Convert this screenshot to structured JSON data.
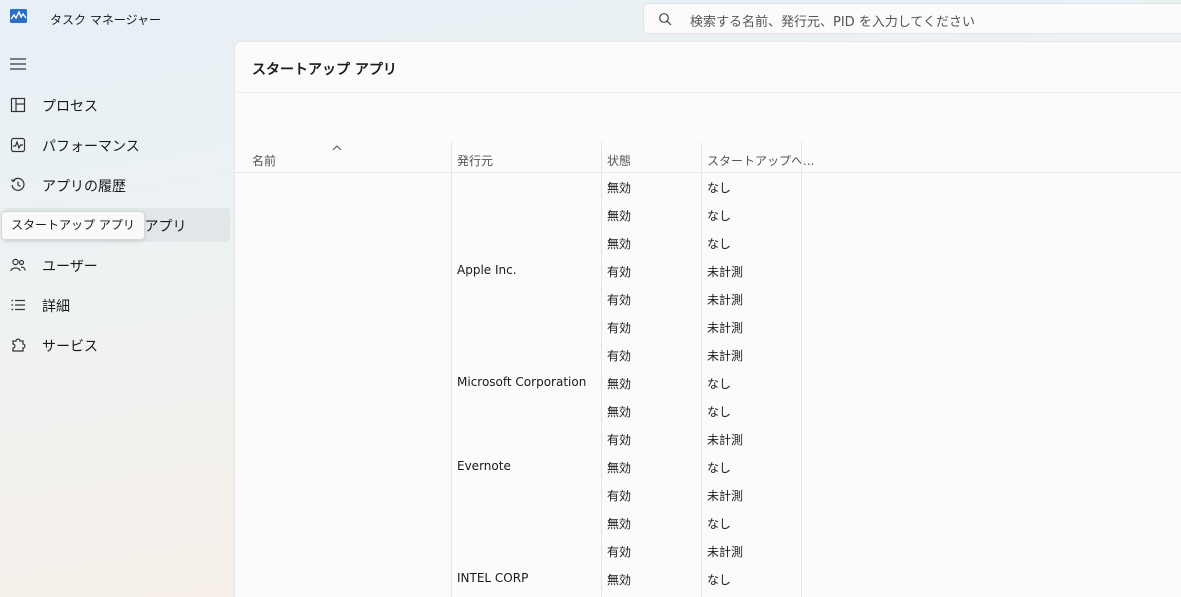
{
  "window": {
    "title": "タスク マネージャー",
    "search_placeholder": "検索する名前、発行元、PID を入力してください"
  },
  "sidebar": {
    "items": [
      {
        "label": "プロセス",
        "icon": "processes-icon"
      },
      {
        "label": "パフォーマンス",
        "icon": "performance-icon"
      },
      {
        "label": "アプリの履歴",
        "icon": "history-icon"
      },
      {
        "label": "スタートアップ アプリ",
        "icon": "startup-icon",
        "selected": true
      },
      {
        "label": "ユーザー",
        "icon": "users-icon"
      },
      {
        "label": "詳細",
        "icon": "details-icon"
      },
      {
        "label": "サービス",
        "icon": "services-icon"
      }
    ],
    "tooltip": "スタートアップ アプリ"
  },
  "main": {
    "title": "スタートアップ アプリ",
    "columns": [
      "名前",
      "発行元",
      "状態",
      "スタートアップへ..."
    ],
    "rows": [
      {
        "publisher": "",
        "status": "無効",
        "impact": "なし"
      },
      {
        "publisher": "",
        "status": "無効",
        "impact": "なし"
      },
      {
        "publisher": "",
        "status": "無効",
        "impact": "なし"
      },
      {
        "publisher": "Apple Inc.",
        "status": "有効",
        "impact": "未計測"
      },
      {
        "publisher": "",
        "status": "有効",
        "impact": "未計測"
      },
      {
        "publisher": "",
        "status": "有効",
        "impact": "未計測"
      },
      {
        "publisher": "",
        "status": "有効",
        "impact": "未計測"
      },
      {
        "publisher": "Microsoft Corporation",
        "status": "無効",
        "impact": "なし"
      },
      {
        "publisher": "",
        "status": "無効",
        "impact": "なし"
      },
      {
        "publisher": "",
        "status": "有効",
        "impact": "未計測"
      },
      {
        "publisher": "Evernote",
        "status": "無効",
        "impact": "なし"
      },
      {
        "publisher": "",
        "status": "有効",
        "impact": "未計測"
      },
      {
        "publisher": "",
        "status": "無効",
        "impact": "なし"
      },
      {
        "publisher": "",
        "status": "有効",
        "impact": "未計測"
      },
      {
        "publisher": "INTEL CORP",
        "status": "無効",
        "impact": "なし"
      }
    ]
  }
}
